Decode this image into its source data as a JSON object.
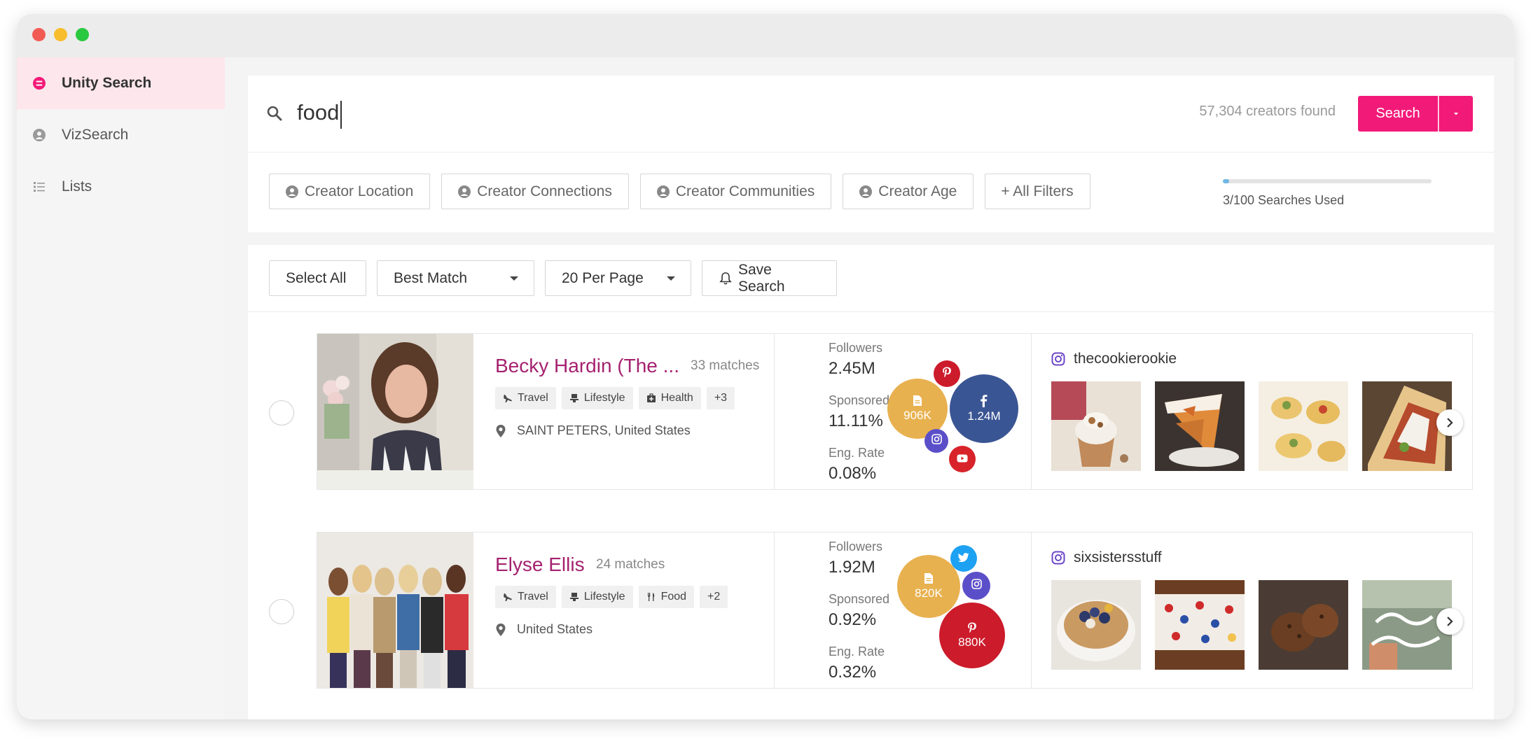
{
  "sidebar": {
    "items": [
      {
        "label": "Unity Search"
      },
      {
        "label": "VizSearch"
      },
      {
        "label": "Lists"
      }
    ]
  },
  "search": {
    "query": "food",
    "results_count": "57,304 creators found",
    "button_label": "Search"
  },
  "filters": {
    "items": [
      {
        "label": "Creator Location"
      },
      {
        "label": "Creator Connections"
      },
      {
        "label": "Creator Communities"
      },
      {
        "label": "Creator Age"
      },
      {
        "label": "+ All Filters"
      }
    ]
  },
  "usage": {
    "label": "3/100 Searches Used",
    "used": 3,
    "limit": 100
  },
  "controls": {
    "select_all": "Select All",
    "sort": "Best Match",
    "per_page": "20 Per Page",
    "save_search": "Save Search"
  },
  "creators": [
    {
      "name": "Becky Hardin (The ...",
      "matches": "33 matches",
      "tags": [
        "Travel",
        "Lifestyle",
        "Health"
      ],
      "more_tags": "+3",
      "location": "SAINT PETERS, United States",
      "followers_label": "Followers",
      "followers": "2.45M",
      "sponsored_label": "Sponsored",
      "sponsored": "11.11%",
      "eng_label": "Eng. Rate",
      "eng": "0.08%",
      "bubbles": [
        {
          "platform": "blog",
          "value": "906K",
          "color": "#e8b14f"
        },
        {
          "platform": "facebook",
          "value": "1.24M",
          "color": "#3a5593"
        },
        {
          "platform": "pinterest",
          "value": "",
          "color": "#cc1b2b"
        },
        {
          "platform": "instagram",
          "value": "",
          "color": "#5b4fc9"
        },
        {
          "platform": "youtube",
          "value": "",
          "color": "#d8232a"
        }
      ],
      "instagram_handle": "thecookierookie"
    },
    {
      "name": "Elyse Ellis",
      "matches": "24 matches",
      "tags": [
        "Travel",
        "Lifestyle",
        "Food"
      ],
      "more_tags": "+2",
      "location": "United States",
      "followers_label": "Followers",
      "followers": "1.92M",
      "sponsored_label": "Sponsored",
      "sponsored": "0.92%",
      "eng_label": "Eng. Rate",
      "eng": "0.32%",
      "bubbles": [
        {
          "platform": "blog",
          "value": "820K",
          "color": "#e8b14f"
        },
        {
          "platform": "pinterest",
          "value": "880K",
          "color": "#cc1b2b"
        },
        {
          "platform": "twitter",
          "value": "",
          "color": "#1da1f2"
        },
        {
          "platform": "instagram",
          "value": "",
          "color": "#5b4fc9"
        }
      ],
      "instagram_handle": "sixsistersstuff"
    }
  ],
  "colors": {
    "accent": "#f21a78",
    "name": "#a5226f",
    "sidebar_active_bg": "#fde6ec"
  }
}
